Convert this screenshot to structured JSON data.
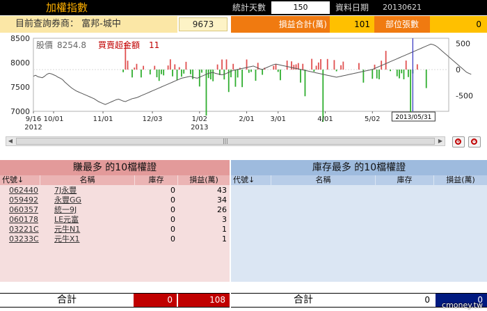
{
  "header": {
    "title": "加權指數",
    "stat_days_label": "統計天數",
    "stat_days_value": "150",
    "data_date_label": "資料日期",
    "data_date_value": "20130621"
  },
  "broker_bar": {
    "broker_label": "目前查詢券商：  富邦-城中",
    "broker_id": "9673",
    "pl_total_label": "損益合計(萬)",
    "pl_total_value": "101",
    "position_label": "部位張數",
    "position_value": "0"
  },
  "chart_data": {
    "type": "line",
    "title": "",
    "legend_price_label": "股價",
    "legend_price_value": "8254.8",
    "legend_buy_label": "買賣超金額",
    "legend_buy_value": "11",
    "y_left": {
      "ticks": [
        "8500",
        "8000",
        "7500",
        "7000"
      ],
      "ylim": [
        7000,
        8500
      ]
    },
    "y_right": {
      "ticks": [
        "500",
        "0",
        "-500"
      ],
      "ylim": [
        -800,
        600
      ]
    },
    "x_ticks": [
      {
        "label": "9/16",
        "label2": "2012",
        "idx": 0
      },
      {
        "label": "10/01",
        "idx": 9
      },
      {
        "label": "11/01",
        "idx": 31
      },
      {
        "label": "12/03",
        "idx": 53
      },
      {
        "label": "1/02",
        "label2": "2013",
        "idx": 74
      },
      {
        "label": "2/01",
        "idx": 95
      },
      {
        "label": "3/01",
        "idx": 109
      },
      {
        "label": "4/01",
        "idx": 130
      },
      {
        "label": "5/02",
        "idx": 151
      }
    ],
    "cursor": {
      "label": "2013/05/31",
      "idx": 169
    },
    "n_points": 186,
    "price": [
      7720,
      7740,
      7710,
      7700,
      7690,
      7720,
      7760,
      7780,
      7770,
      7750,
      7730,
      7700,
      7680,
      7650,
      7600,
      7560,
      7520,
      7480,
      7450,
      7420,
      7400,
      7380,
      7360,
      7340,
      7320,
      7300,
      7280,
      7260,
      7230,
      7200,
      7180,
      7160,
      7140,
      7160,
      7180,
      7200,
      7220,
      7240,
      7250,
      7230,
      7210,
      7200,
      7220,
      7240,
      7260,
      7270,
      7280,
      7300,
      7320,
      7340,
      7360,
      7380,
      7400,
      7420,
      7440,
      7460,
      7480,
      7500,
      7520,
      7540,
      7560,
      7580,
      7600,
      7620,
      7640,
      7660,
      7680,
      7690,
      7700,
      7710,
      7720,
      7700,
      7690,
      7680,
      7700,
      7720,
      7740,
      7760,
      7780,
      7790,
      7800,
      7780,
      7770,
      7760,
      7750,
      7760,
      7780,
      7800,
      7820,
      7840,
      7850,
      7860,
      7870,
      7880,
      7890,
      7900,
      7910,
      7920,
      7930,
      7910,
      7890,
      7870,
      7860,
      7880,
      7900,
      7920,
      7940,
      7960,
      7970,
      7960,
      7950,
      7940,
      7930,
      7920,
      7910,
      7900,
      7890,
      7880,
      7870,
      7860,
      7850,
      7840,
      7830,
      7820,
      7810,
      7800,
      7790,
      7780,
      7770,
      7760,
      7750,
      7740,
      7730,
      7720,
      7710,
      7700,
      7710,
      7720,
      7730,
      7740,
      7750,
      7760,
      7770,
      7780,
      7790,
      7800,
      7810,
      7820,
      7830,
      7840,
      7850,
      7860,
      7880,
      7900,
      7920,
      7940,
      7960,
      7980,
      8000,
      8020,
      8040,
      8060,
      8080,
      8100,
      8120,
      8140,
      8160,
      8180,
      8200,
      8220,
      8240,
      8260,
      8280,
      8300,
      8320,
      8340,
      8360,
      8380,
      8370,
      8350,
      8320,
      8280,
      8240,
      8200,
      8160,
      8120,
      8080,
      8040,
      8000,
      7960,
      7920,
      7880,
      7840,
      7800,
      7780,
      7760
    ]
  },
  "left_panel": {
    "title": "賺最多 的10檔權證",
    "columns": [
      "代號↓",
      "名稱",
      "庫存",
      "損益(萬)"
    ],
    "rows": [
      {
        "code": "062440",
        "name": "7J永豐",
        "inv": "0",
        "pl": "43"
      },
      {
        "code": "059492",
        "name": "永豐GG",
        "inv": "0",
        "pl": "34"
      },
      {
        "code": "060357",
        "name": "統一9J",
        "inv": "0",
        "pl": "26"
      },
      {
        "code": "060178",
        "name": "LE元富",
        "inv": "0",
        "pl": "3"
      },
      {
        "code": "03221C",
        "name": "元牛N1",
        "inv": "0",
        "pl": "1"
      },
      {
        "code": "03233C",
        "name": "元牛X1",
        "inv": "0",
        "pl": "1"
      }
    ],
    "total_label": "合計",
    "total_inv": "0",
    "total_pl": "108"
  },
  "right_panel": {
    "title": "庫存最多 的10檔權證",
    "columns": [
      "代號↓",
      "名稱",
      "庫存",
      "損益(萬)"
    ],
    "total_label": "合計",
    "total_inv": "0",
    "total_pl": "0"
  },
  "scrollbar": {
    "grip": "|||"
  },
  "watermark": "cmoney.tw",
  "colors": {
    "buy": "#e05050",
    "sell": "#2fae2f",
    "cursor": "#3030c0"
  }
}
